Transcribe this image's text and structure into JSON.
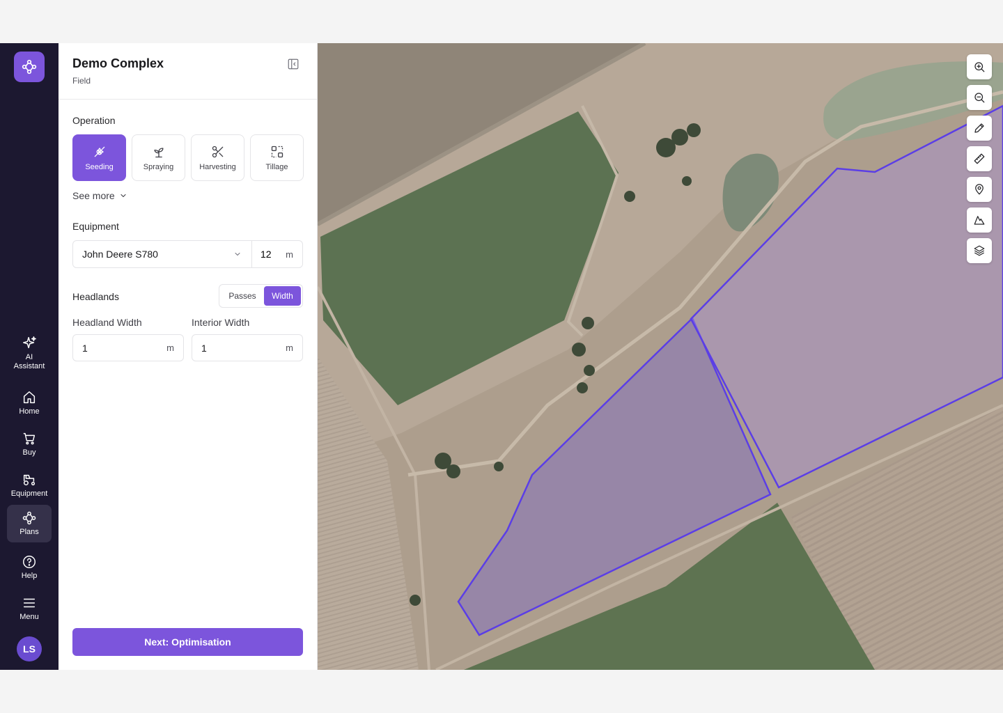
{
  "rail": {
    "logo_icon": "plans-network-icon",
    "items": [
      {
        "id": "ai",
        "label": "AI Assistant",
        "icon": "sparkle-icon"
      },
      {
        "id": "home",
        "label": "Home",
        "icon": "home-icon"
      },
      {
        "id": "buy",
        "label": "Buy",
        "icon": "cart-icon"
      },
      {
        "id": "equipment",
        "label": "Equipment",
        "icon": "tractor-icon"
      },
      {
        "id": "plans",
        "label": "Plans",
        "icon": "plans-network-icon",
        "active": true
      },
      {
        "id": "help",
        "label": "Help",
        "icon": "help-circle-icon"
      },
      {
        "id": "menu",
        "label": "Menu",
        "icon": "menu-icon"
      }
    ],
    "avatar_initials": "LS"
  },
  "panel": {
    "title": "Demo Complex",
    "subtitle": "Field",
    "operation_label": "Operation",
    "operations": [
      {
        "label": "Seeding",
        "icon": "wheat-icon",
        "active": true
      },
      {
        "label": "Spraying",
        "icon": "sprout-icon"
      },
      {
        "label": "Harvesting",
        "icon": "scissors-icon"
      },
      {
        "label": "Tillage",
        "icon": "grid-icon"
      }
    ],
    "see_more": "See more",
    "equipment_label": "Equipment",
    "equipment_value": "John Deere S780",
    "equipment_width": "12",
    "equipment_unit": "m",
    "headlands_label": "Headlands",
    "headlands_modes": [
      "Passes",
      "Width"
    ],
    "headlands_selected": "Width",
    "headland_width_label": "Headland Width",
    "headland_width_value": "1",
    "interior_width_label": "Interior Width",
    "interior_width_value": "1",
    "unit_m": "m",
    "next_button": "Next: Optimisation"
  },
  "map": {
    "tools": [
      "zoom-in-icon",
      "zoom-out-icon",
      "pencil-icon",
      "ruler-icon",
      "pin-icon",
      "terrain-icon",
      "layers-icon"
    ],
    "accent": "#7c55dc"
  },
  "colors": {
    "accent": "#7c55dc",
    "rail_bg": "#1c1830"
  }
}
